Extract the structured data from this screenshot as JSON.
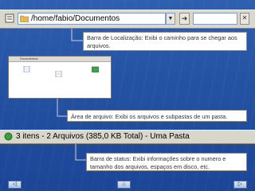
{
  "location_bar": {
    "path": "/home/fabio/Documentos",
    "dropdown_icon": "chevron-down-icon",
    "go_icon": "arrow-icon",
    "end_icon": "clear-icon"
  },
  "file_area": {
    "title": "Documentos",
    "items": [
      {
        "icon": "file-icon"
      },
      {
        "icon": "document-icon"
      },
      {
        "icon": "image-icon"
      }
    ]
  },
  "status_bar": {
    "text": "3 itens - 2 Arquivos (385,0 KB Total) - Uma Pasta",
    "icon": "status-icon"
  },
  "callouts": {
    "location": "Barra de Localização: Exibi o caminho para se chegar aos arquivos.",
    "files": "Área de arquivo: Exibi os arquivos e subpastas de um pasta.",
    "status": "Barra de status: Exibi informações sobre o numero e tamanho dos arquivos, espaços em disco, etc."
  },
  "navigation": {
    "prev_symbol": "◁",
    "home_symbol": "⌂",
    "next_symbol": "▷"
  },
  "colors": {
    "background": "#2553a4",
    "strip": "#d9d6cc",
    "callout_bg": "#ffffff"
  }
}
